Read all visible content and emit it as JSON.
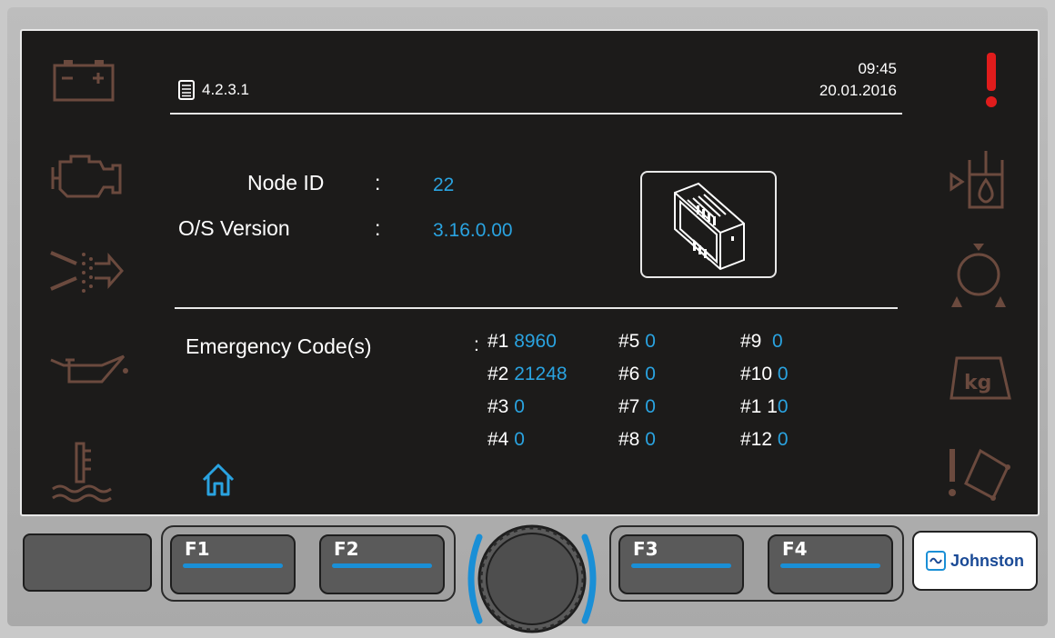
{
  "header": {
    "menu_code": "4.2.3.1",
    "time": "09:45",
    "date": "20.01.2016"
  },
  "info": {
    "node_id_label": "Node ID",
    "node_id_sep": ":",
    "node_id_value": "22",
    "os_label": "O/S Version",
    "os_sep": ":",
    "os_value": "3.16.0.00"
  },
  "emergency": {
    "label": "Emergency Code(s)",
    "sep": ":",
    "codes": [
      {
        "id": "#1",
        "value": "8960"
      },
      {
        "id": "#2",
        "value": "21248"
      },
      {
        "id": "#3",
        "value": "0"
      },
      {
        "id": "#4",
        "value": "0"
      },
      {
        "id": "#5",
        "value": "0"
      },
      {
        "id": "#6",
        "value": "0"
      },
      {
        "id": "#7",
        "value": "0"
      },
      {
        "id": "#8",
        "value": "0"
      },
      {
        "id": "#9",
        "value": "0"
      },
      {
        "id": "#10",
        "value": "0"
      },
      {
        "id": "#1 1",
        "value": "0"
      },
      {
        "id": "#12",
        "value": "0"
      }
    ]
  },
  "buttons": {
    "f1": "F1",
    "f2": "F2",
    "f3": "F3",
    "f4": "F4"
  },
  "brand": "Johnston",
  "icons": {
    "left": [
      "battery-icon",
      "engine-icon",
      "airflow-icon",
      "oil-can-icon",
      "coolant-temp-icon"
    ],
    "right": [
      "alert-icon",
      "water-tank-icon",
      "pump-icon",
      "weight-kg-icon",
      "tilt-warning-icon"
    ],
    "home": "home-icon",
    "menu": "document-icon"
  },
  "colors": {
    "accent": "#2aa3e0",
    "alert": "#e01c1c",
    "side_icon": "#6b4a3e",
    "screen_bg": "#1c1b1a"
  }
}
